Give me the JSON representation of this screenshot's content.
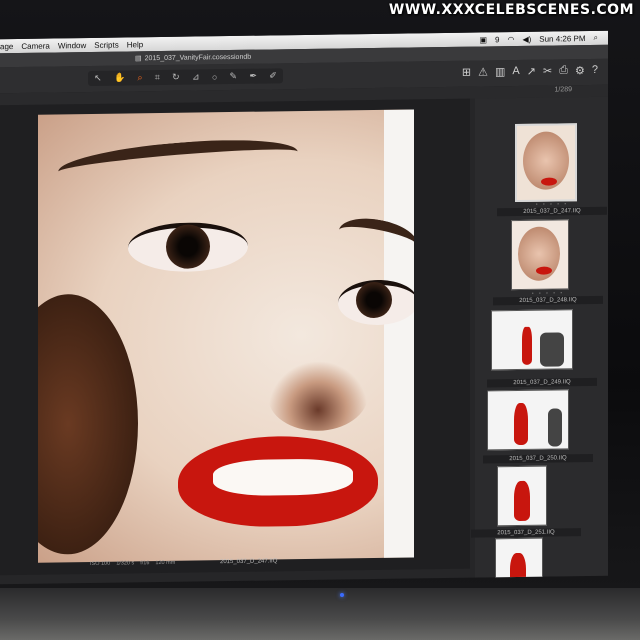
{
  "watermark": "WWW.XXXCELEBSCENES.COM",
  "menubar": {
    "items": [
      "age",
      "Camera",
      "Window",
      "Scripts",
      "Help"
    ],
    "clock": "Sun 4:26 PM",
    "status_num": "9"
  },
  "window": {
    "title": "2015_037_VanityFair.cosessiondb"
  },
  "toolbar": {
    "count": "1/289"
  },
  "viewer": {
    "filename": "2015_037_D_247.IIQ",
    "meta": [
      "ISO 100",
      "1/320 s",
      "f/16",
      "120 mm"
    ]
  },
  "thumbnails": [
    {
      "label": "2015_037_D_247.IIQ",
      "selected": true
    },
    {
      "label": "2015_037_D_248.IIQ",
      "selected": false
    },
    {
      "label": "2015_037_D_249.IIQ",
      "selected": false
    },
    {
      "label": "2015_037_D_250.IIQ",
      "selected": false
    },
    {
      "label": "2015_037_D_251.IIQ",
      "selected": false
    },
    {
      "label": "",
      "selected": false
    }
  ],
  "colors": {
    "accent": "#ff6a1a",
    "lip_red": "#c8160e"
  }
}
